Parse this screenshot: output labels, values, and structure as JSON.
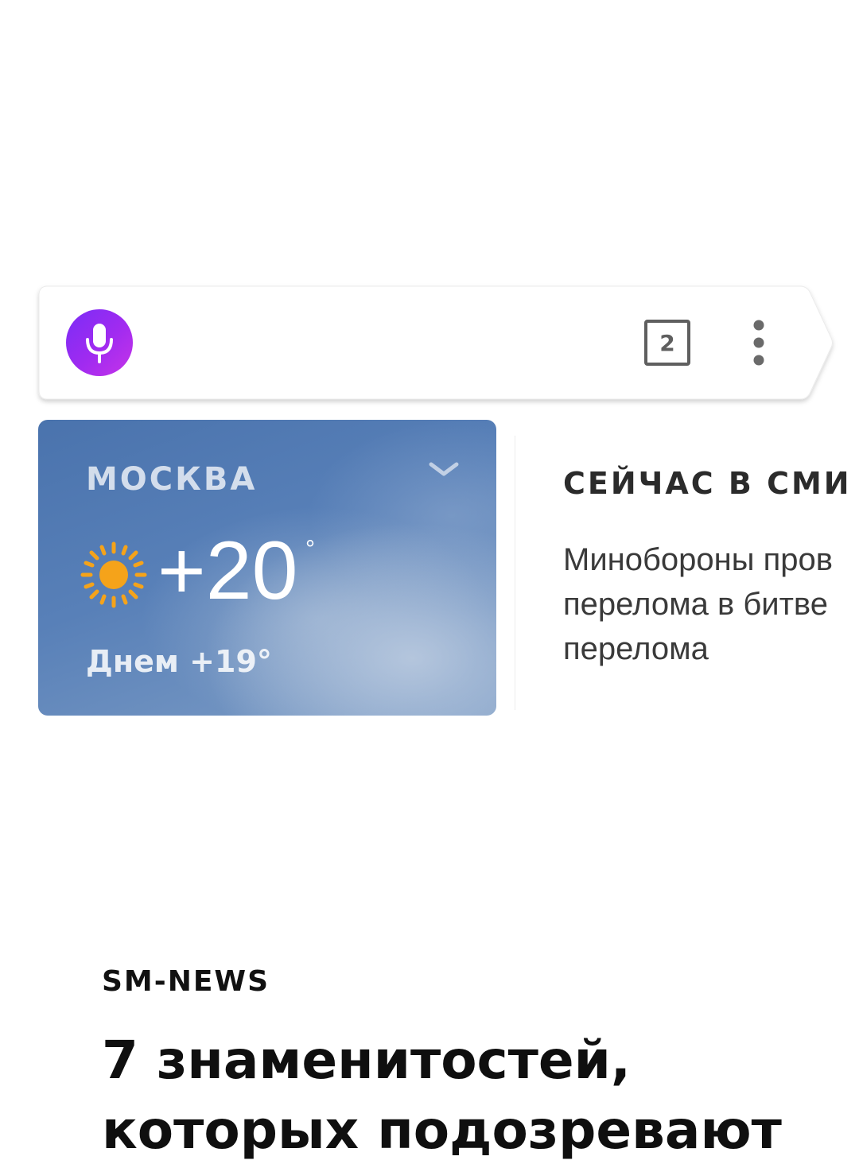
{
  "searchbar": {
    "mic_icon": "microphone-icon",
    "tabs_count": "2",
    "menu_icon": "more-vertical-icon"
  },
  "weather": {
    "city": "МОСКВА",
    "temperature": "+20",
    "degree_symbol": "°",
    "day_forecast": "Днем +19°",
    "condition_icon": "sun-icon",
    "expand_icon": "chevron-down-icon"
  },
  "news": {
    "heading": "СЕЙЧАС В СМИ",
    "headline_text": "Минобороны пров\nперелома в битве\nперелома"
  },
  "article": {
    "source": "SM-NEWS",
    "title": "7 знаменитостей,\nкоторых подозревают"
  },
  "colors": {
    "mic_gradient_start": "#7a2cf6",
    "mic_gradient_end": "#c634e8",
    "weather_bg": "#4a73ad",
    "sun": "#f5a31a"
  }
}
